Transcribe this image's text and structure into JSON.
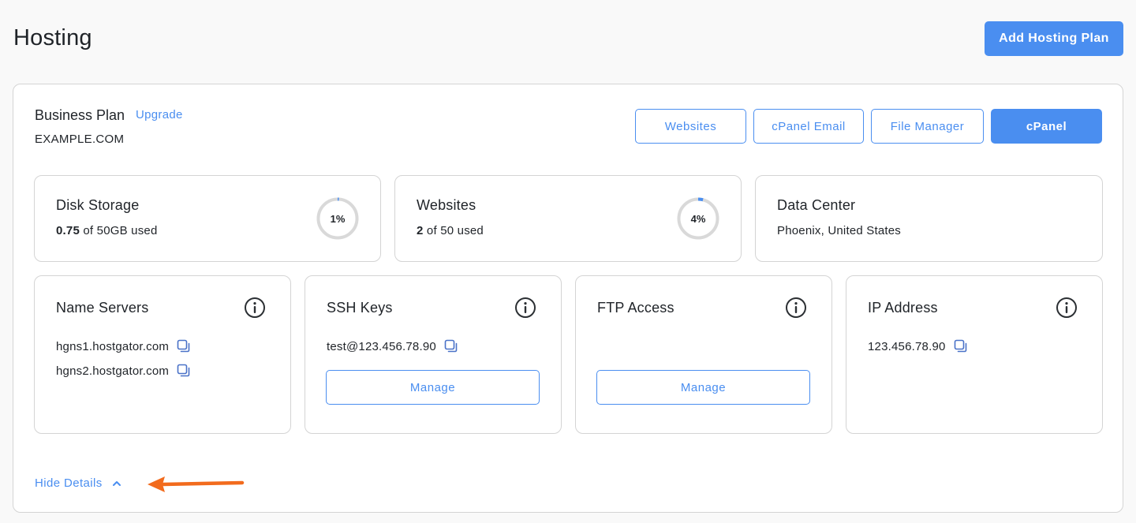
{
  "page": {
    "title": "Hosting",
    "add_button_label": "Add Hosting Plan"
  },
  "plan": {
    "name": "Business Plan",
    "upgrade_label": "Upgrade",
    "domain": "EXAMPLE.COM",
    "actions": {
      "websites": "Websites",
      "cpanel_email": "cPanel Email",
      "file_manager": "File Manager",
      "cpanel": "cPanel"
    }
  },
  "stats": {
    "disk": {
      "title": "Disk Storage",
      "used": "0.75",
      "used_suffix": "of 50GB used",
      "percent_label": "1%",
      "percent": 1
    },
    "websites": {
      "title": "Websites",
      "used": "2",
      "used_suffix": "of 50 used",
      "percent_label": "4%",
      "percent": 4
    },
    "datacenter": {
      "title": "Data Center",
      "location": "Phoenix, United States"
    }
  },
  "details": {
    "name_servers": {
      "title": "Name Servers",
      "items": [
        "hgns1.hostgator.com",
        "hgns2.hostgator.com"
      ]
    },
    "ssh_keys": {
      "title": "SSH Keys",
      "value": "test@123.456.78.90",
      "manage_label": "Manage"
    },
    "ftp": {
      "title": "FTP Access",
      "manage_label": "Manage"
    },
    "ip": {
      "title": "IP Address",
      "value": "123.456.78.90"
    }
  },
  "footer": {
    "hide_details_label": "Hide Details"
  },
  "colors": {
    "accent": "#4a8ef0",
    "ring_track": "#d9d9d9",
    "annotation_arrow": "#f26b1d"
  },
  "icons": {
    "info": "info-circle-icon",
    "copy": "copy-icon",
    "chevron": "chevron-up-icon",
    "annotation": "arrow-left-icon"
  }
}
